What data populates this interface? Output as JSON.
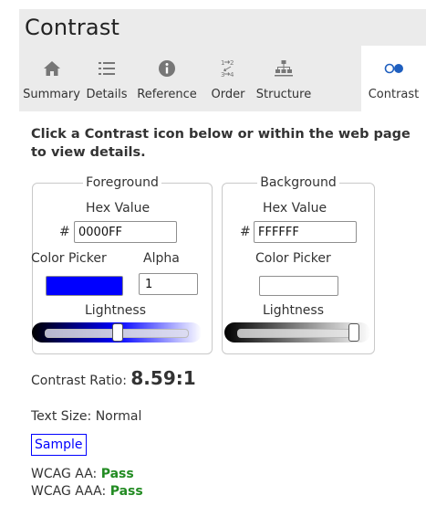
{
  "header": {
    "title": "Contrast"
  },
  "tabs": [
    {
      "label": "Summary",
      "icon": "home-icon"
    },
    {
      "label": "Details",
      "icon": "list-icon"
    },
    {
      "label": "Reference",
      "icon": "info-icon"
    },
    {
      "label": "Order",
      "icon": "order-icon"
    },
    {
      "label": "Structure",
      "icon": "structure-icon"
    },
    {
      "label": "Contrast",
      "icon": "contrast-icon",
      "active": true
    }
  ],
  "intro": "Click a Contrast icon below or within the web page to view details.",
  "foreground": {
    "legend": "Foreground",
    "hex_label": "Hex Value",
    "hash": "#",
    "hex_value": "0000FF",
    "picker_label": "Color Picker",
    "alpha_label": "Alpha",
    "alpha_value": "1",
    "lightness_label": "Lightness",
    "color": "#0000ff",
    "lightness": 0.5
  },
  "background": {
    "legend": "Background",
    "hex_label": "Hex Value",
    "hash": "#",
    "hex_value": "FFFFFF",
    "picker_label": "Color Picker",
    "lightness_label": "Lightness",
    "color": "#ffffff",
    "lightness": 1.0
  },
  "results": {
    "ratio_label": "Contrast Ratio:",
    "ratio_value": "8.59:1",
    "text_size_label": "Text Size:",
    "text_size_value": "Normal",
    "sample_text": "Sample",
    "wcag_aa_label": "WCAG AA:",
    "wcag_aa_value": "Pass",
    "wcag_aaa_label": "WCAG AAA:",
    "wcag_aaa_value": "Pass",
    "pass_color": "#228b22"
  }
}
